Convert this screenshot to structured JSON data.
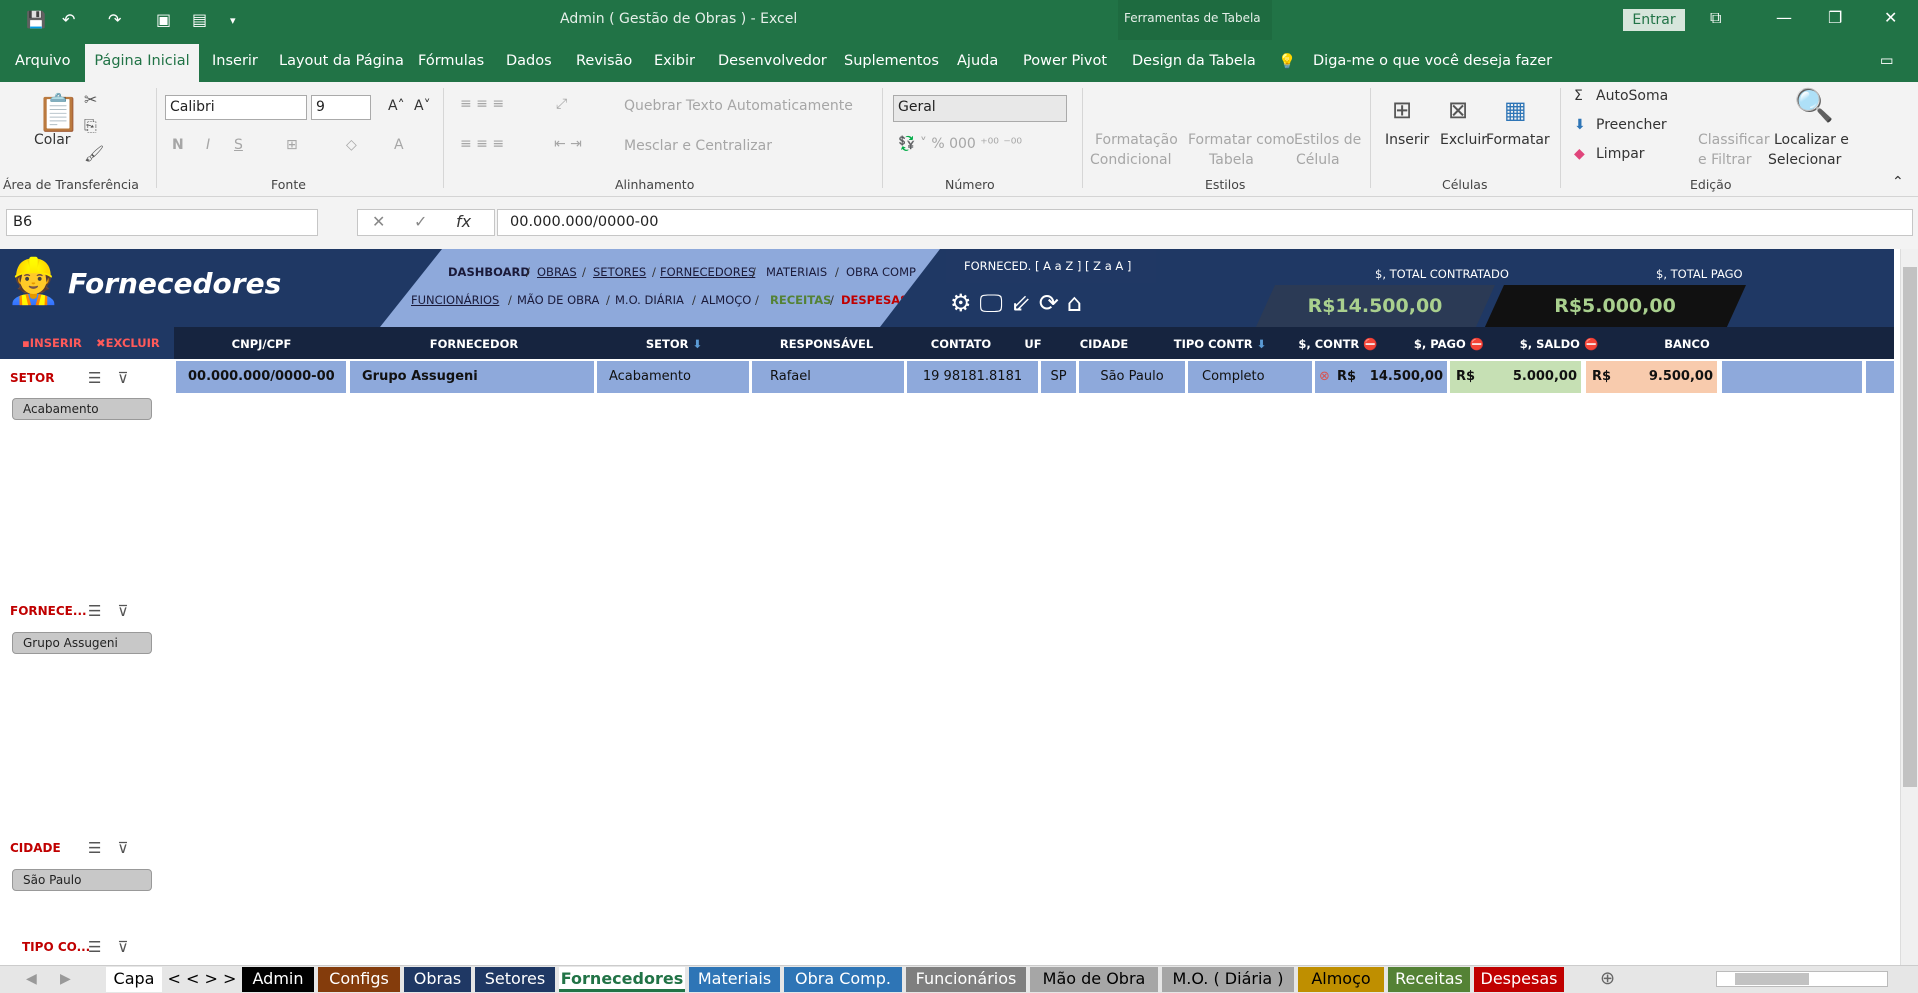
{
  "window": {
    "title": "Admin ( Gestão de Obras )  -  Excel",
    "tool_tab": "Ferramentas de Tabela",
    "signin": "Entrar"
  },
  "menu": [
    "Arquivo",
    "Página Inicial",
    "Inserir",
    "Layout da Página",
    "Fórmulas",
    "Dados",
    "Revisão",
    "Exibir",
    "Desenvolvedor",
    "Suplementos",
    "Ajuda",
    "Power Pivot",
    "Design da Tabela"
  ],
  "tell_me": "Diga-me o que você deseja fazer",
  "ribbon": {
    "paste": "Colar",
    "clipboard": "Área de Transferência",
    "font_name": "Calibri",
    "font_size": "9",
    "font_group": "Fonte",
    "bold": "N",
    "italic": "I",
    "underline": "S",
    "wrap": "Quebrar Texto Automaticamente",
    "merge": "Mesclar e Centralizar",
    "align_group": "Alinhamento",
    "number_format": "Geral",
    "number_group": "Número",
    "cond_fmt_1": "Formatação",
    "cond_fmt_2": "Condicional",
    "fmt_table_1": "Formatar como",
    "fmt_table_2": "Tabela",
    "cell_styles_1": "Estilos de",
    "cell_styles_2": "Célula",
    "styles_group": "Estilos",
    "insert": "Inserir",
    "delete": "Excluir",
    "format": "Formatar",
    "cells_group": "Células",
    "autosum": "AutoSoma",
    "fill": "Preencher",
    "clear": "Limpar",
    "sort_1": "Classificar",
    "sort_2": "e Filtrar",
    "find_1": "Localizar e",
    "find_2": "Selecionar",
    "edit_group": "Edição"
  },
  "formula_bar": {
    "name_box": "B6",
    "formula": "00.000.000/0000-00",
    "fx": "fx"
  },
  "sheet": {
    "title": "Fornecedores",
    "nav_row1": [
      "DASHBOARD",
      "OBRAS",
      "SETORES",
      "FORNECEDORES",
      "MATERIAIS",
      "OBRA COMP"
    ],
    "nav_row2": [
      "FUNCIONÁRIOS",
      "MÃO DE OBRA",
      "M.O. DIÁRIA",
      "ALMOÇO",
      "RECEITAS",
      "DESPESAS"
    ],
    "sort_label": "FORNECED.  [ A a Z ] [ Z a A ]",
    "kpi_contratado_label": "$, TOTAL CONTRATADO",
    "kpi_contratado": "R$14.500,00",
    "kpi_pago_label": "$, TOTAL PAGO",
    "kpi_pago": "R$5.000,00",
    "btn_insert": "INSERIR",
    "btn_delete": "EXCLUIR",
    "headers": [
      "CNPJ/CPF",
      "FORNECEDOR",
      "SETOR",
      "RESPONSÁVEL",
      "CONTATO",
      "UF",
      "CIDADE",
      "TIPO CONTR",
      "$, CONTR",
      "$, PAGO",
      "$, SALDO",
      "BANCO"
    ],
    "row": {
      "cnpj": "00.000.000/0000-00",
      "fornecedor": "Grupo Assugeni",
      "setor": "Acabamento",
      "responsavel": "Rafael",
      "contato": "19 98181.8181",
      "uf": "SP",
      "cidade": "São Paulo",
      "tipo": "Completo",
      "contr_cur": "R$",
      "contr": "14.500,00",
      "pago_cur": "R$",
      "pago": "5.000,00",
      "saldo_cur": "R$",
      "saldo": "9.500,00",
      "banco": ""
    },
    "slicers": [
      {
        "title": "SETOR",
        "item": "Acabamento"
      },
      {
        "title": "FORNECE...",
        "item": "Grupo Assugeni"
      },
      {
        "title": "CIDADE",
        "item": "São Paulo"
      },
      {
        "title": "TIPO CO...",
        "item": ""
      }
    ]
  },
  "tabs": [
    {
      "label": "Capa",
      "bg": "#ffffff",
      "fg": "#000000"
    },
    {
      "label": "< < > >",
      "bg": "#e6e6e6",
      "fg": "#000000"
    },
    {
      "label": "Admin",
      "bg": "#000000",
      "fg": "#ffffff"
    },
    {
      "label": "Configs",
      "bg": "#843c0c",
      "fg": "#ffffff"
    },
    {
      "label": "Obras",
      "bg": "#1f3864",
      "fg": "#ffffff"
    },
    {
      "label": "Setores",
      "bg": "#1f3864",
      "fg": "#ffffff"
    },
    {
      "label": "Fornecedores",
      "bg": "#ffffff",
      "fg": "#217346"
    },
    {
      "label": "Materiais",
      "bg": "#2e75b6",
      "fg": "#ffffff"
    },
    {
      "label": "Obra Comp.",
      "bg": "#2e75b6",
      "fg": "#ffffff"
    },
    {
      "label": "Funcionários",
      "bg": "#7f7f7f",
      "fg": "#ffffff"
    },
    {
      "label": "Mão de Obra",
      "bg": "#a6a6a6",
      "fg": "#000000"
    },
    {
      "label": "M.O. ( Diária )",
      "bg": "#a6a6a6",
      "fg": "#000000"
    },
    {
      "label": "Almoço",
      "bg": "#bf8f00",
      "fg": "#000000"
    },
    {
      "label": "Receitas",
      "bg": "#548235",
      "fg": "#ffffff"
    },
    {
      "label": "Despesas",
      "bg": "#c00000",
      "fg": "#ffffff"
    }
  ]
}
